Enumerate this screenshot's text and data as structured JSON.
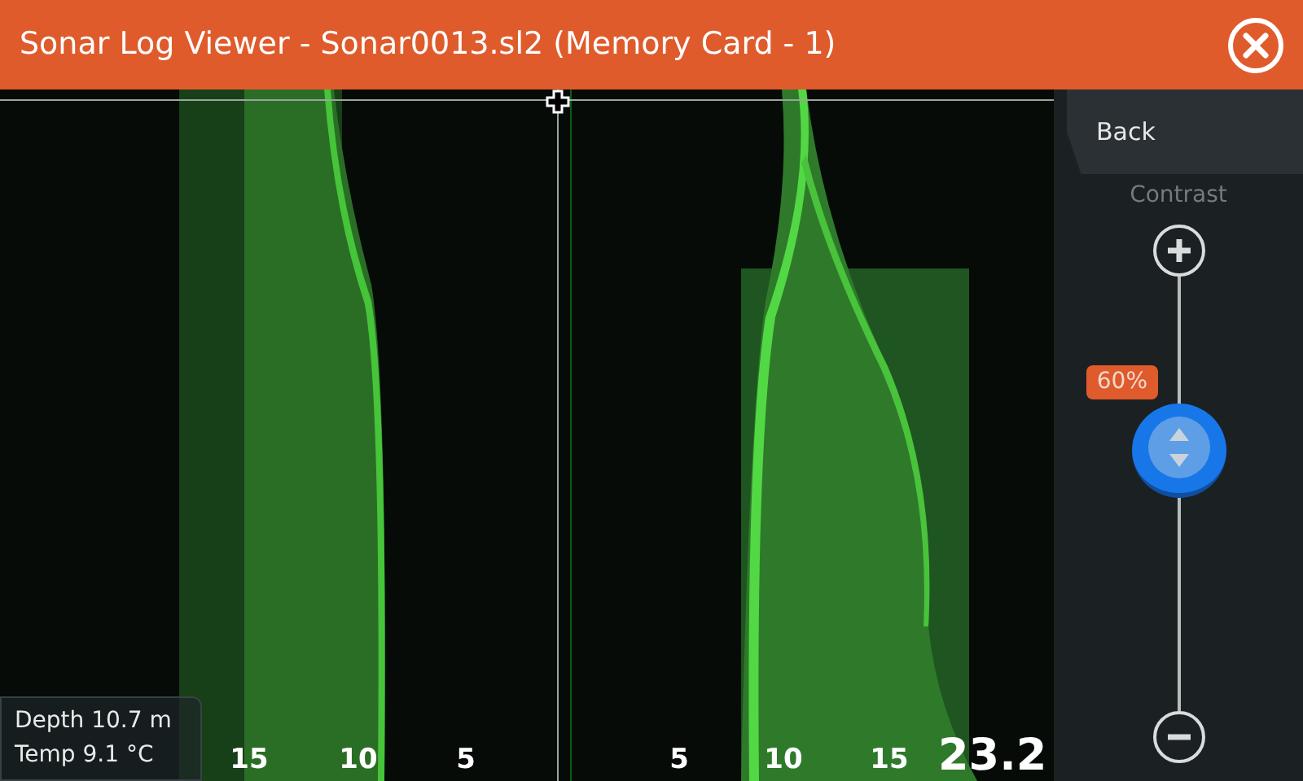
{
  "window": {
    "title": "Sonar Log Viewer - Sonar0013.sl2 (Memory Card - 1)"
  },
  "sonar": {
    "left_scale": [
      "15",
      "10",
      "5"
    ],
    "right_scale": [
      "5",
      "10",
      "15"
    ],
    "right_reading": "23.2",
    "info": [
      {
        "label": "Depth",
        "value": "10.7  m"
      },
      {
        "label": "Temp",
        "value": "9.1 °C"
      }
    ]
  },
  "panel": {
    "back": "Back",
    "contrast": {
      "label": "Contrast",
      "level": 0.6,
      "reading": "60%"
    }
  }
}
